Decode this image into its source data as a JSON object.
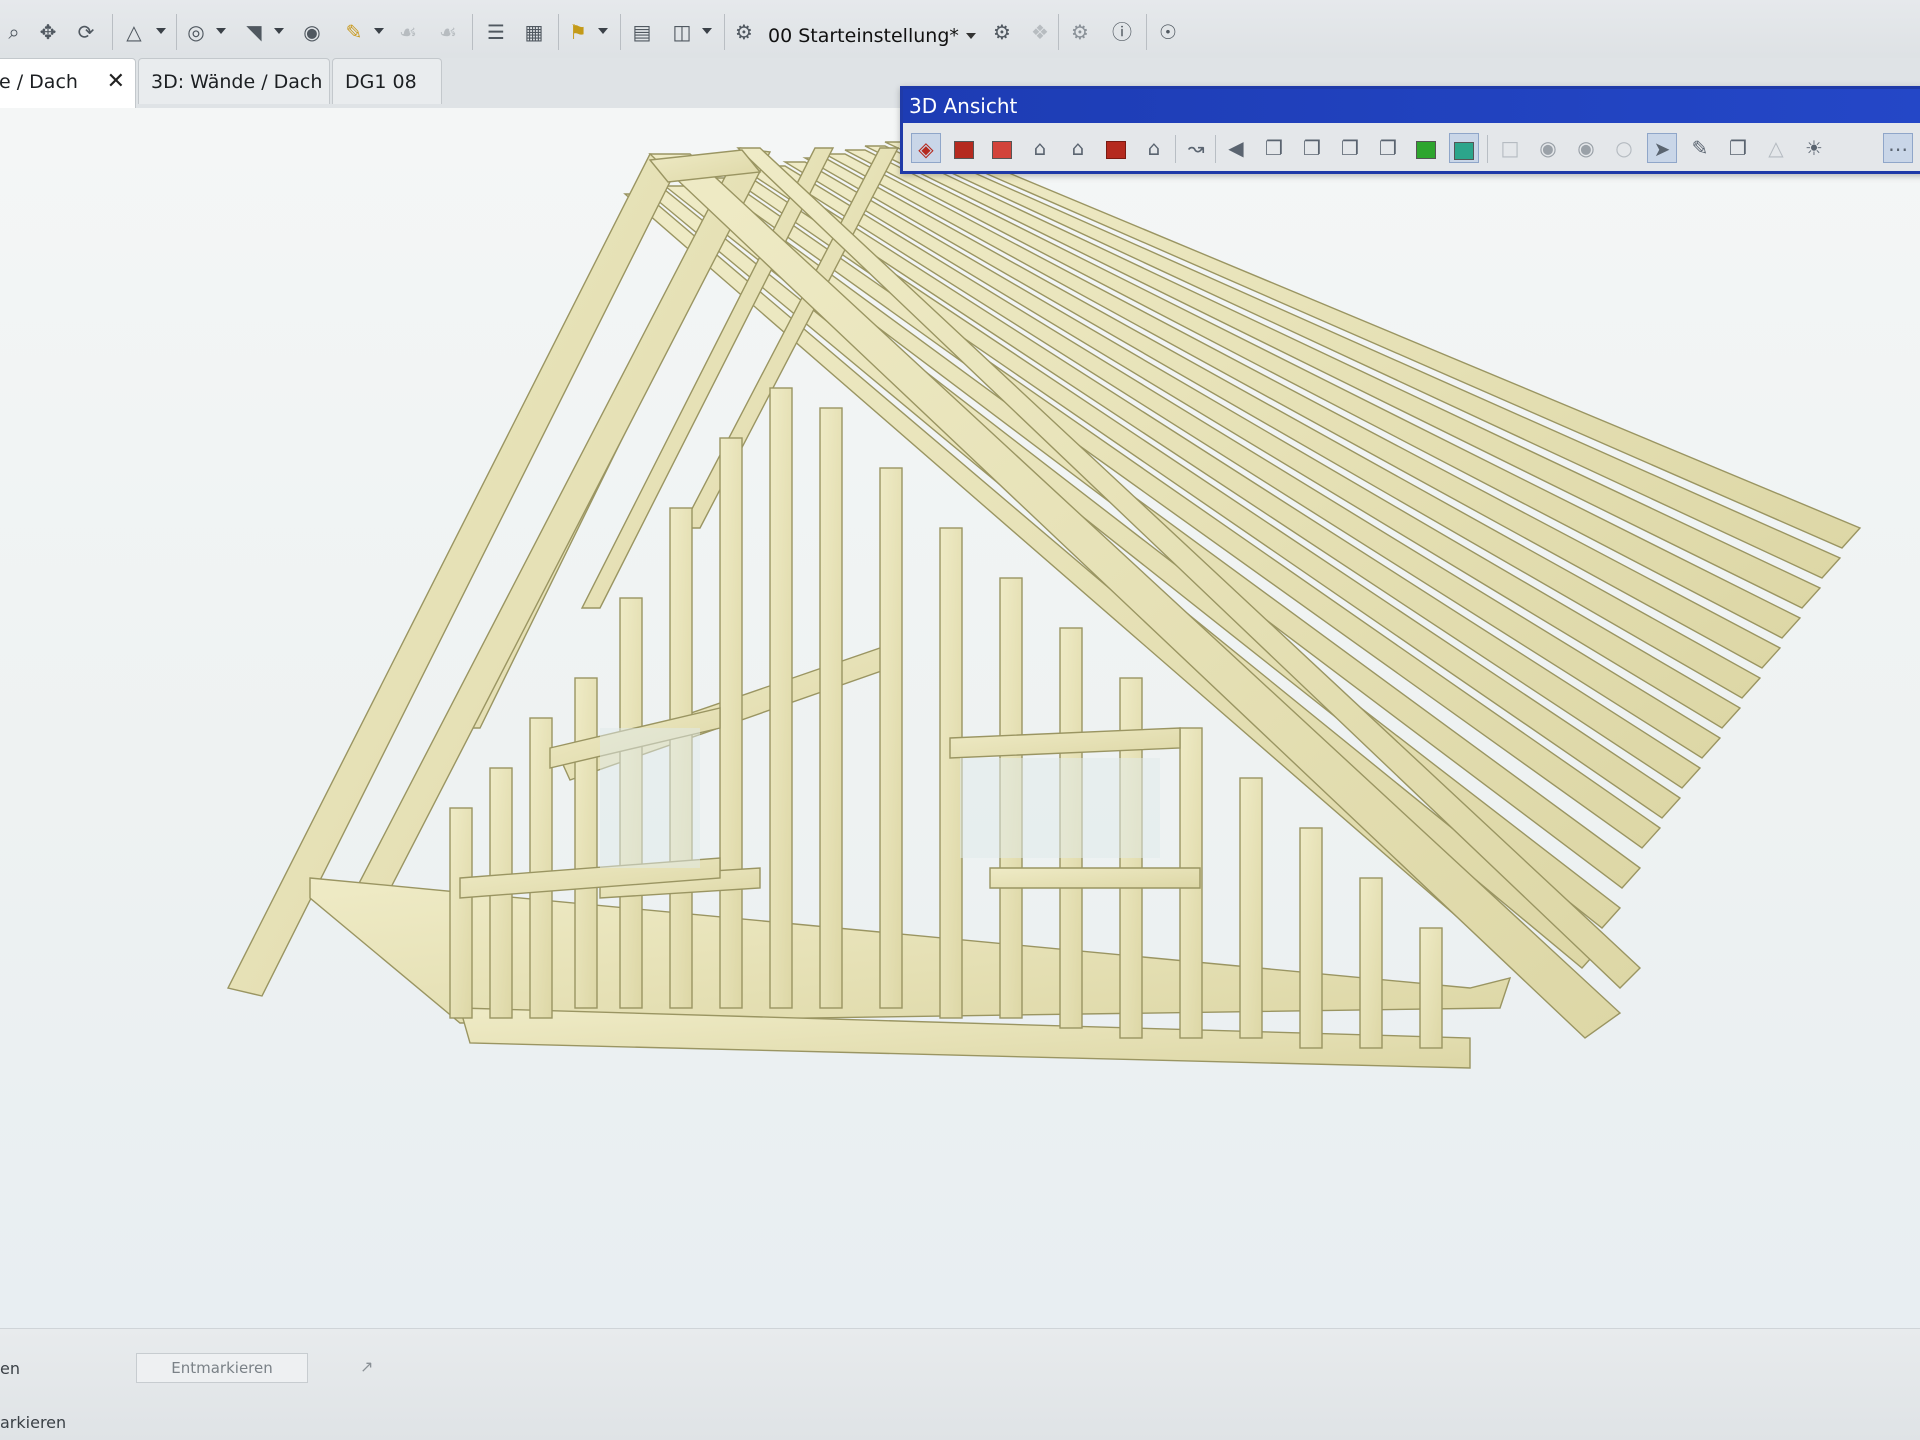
{
  "toolbar": {
    "view_select_value": "00 Starteinstellung*",
    "icons": [
      "zoom-icon",
      "pan-icon",
      "orbit-icon",
      "navigate-icon",
      "view-icon",
      "section-icon",
      "eye-icon",
      "paint-icon",
      "layers-icon",
      "layout-icon",
      "markup-icon",
      "print-icon",
      "sidebar-icon",
      "view-map-icon",
      "settings-icon",
      "info-icon",
      "binoculars-icon"
    ]
  },
  "tabs": [
    {
      "label": "e / Dach",
      "active": true,
      "close_label": "✕"
    },
    {
      "label": "3D: Wände / Dach",
      "active": false
    },
    {
      "label": "DG1 08",
      "active": false
    }
  ],
  "palette": {
    "title": "3D Ansicht",
    "colors": {
      "title_bg": "#1d3cb4",
      "red": "#b52a1f",
      "green": "#2ea52e",
      "teal": "#2ca58b"
    }
  },
  "viewport": {
    "subject": "3D wooden roof truss",
    "colors": {
      "wood": "#e9e4b8",
      "wood_edge": "#9a9562"
    }
  },
  "bottom": {
    "row1_text": "en",
    "row2_text": "arkieren",
    "button_label": "Entmarkieren"
  }
}
